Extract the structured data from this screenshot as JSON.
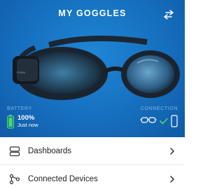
{
  "header": {
    "title": "MY GOGGLES",
    "swap_icon": "swap-arrows-icon"
  },
  "status": {
    "battery_label": "BATTERY",
    "battery_percent": "100%",
    "battery_updated": "Just now",
    "battery_level": 1.0,
    "battery_color": "#4cd964",
    "connection_label": "CONNECTION",
    "connection_ok_color": "#4cd964"
  },
  "menu": {
    "items": [
      {
        "label": "Dashboards",
        "icon": "dashboard-cards-icon"
      },
      {
        "label": "Connected Devices",
        "icon": "connected-nodes-icon"
      }
    ]
  },
  "colors": {
    "hero": "#166fbe",
    "label": "#7fb3e2"
  }
}
